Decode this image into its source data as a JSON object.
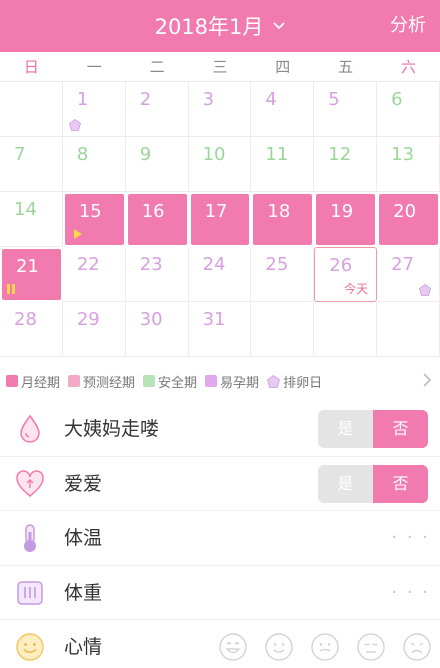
{
  "header": {
    "month": "2018年1月",
    "analyze": "分析"
  },
  "weekdays": [
    "日",
    "一",
    "二",
    "三",
    "四",
    "五",
    "六"
  ],
  "calendar": {
    "days": [
      {
        "n": "1"
      },
      {
        "n": "2"
      },
      {
        "n": "3"
      },
      {
        "n": "4"
      },
      {
        "n": "5"
      },
      {
        "n": "6"
      },
      {
        "n": "7"
      },
      {
        "n": "8"
      },
      {
        "n": "9"
      },
      {
        "n": "10"
      },
      {
        "n": "11"
      },
      {
        "n": "12"
      },
      {
        "n": "13"
      },
      {
        "n": "14"
      },
      {
        "n": "15"
      },
      {
        "n": "16"
      },
      {
        "n": "17"
      },
      {
        "n": "18"
      },
      {
        "n": "19"
      },
      {
        "n": "20"
      },
      {
        "n": "21"
      },
      {
        "n": "22"
      },
      {
        "n": "23"
      },
      {
        "n": "24"
      },
      {
        "n": "25"
      },
      {
        "n": "26"
      },
      {
        "n": "27"
      },
      {
        "n": "28"
      },
      {
        "n": "29"
      },
      {
        "n": "30"
      },
      {
        "n": "31"
      }
    ],
    "today_label": "今天"
  },
  "legend": {
    "items": [
      {
        "label": "月经期",
        "color": "#f17aae"
      },
      {
        "label": "预测经期",
        "color": "#f4a9c9"
      },
      {
        "label": "安全期",
        "color": "#b8e3b6"
      },
      {
        "label": "易孕期",
        "color": "#e2a8ec"
      },
      {
        "label": "排卵日",
        "color": "#e8c9f2"
      }
    ]
  },
  "records": {
    "period": {
      "label": "大姨妈走喽",
      "yes": "是",
      "no": "否"
    },
    "love": {
      "label": "爱爱",
      "yes": "是",
      "no": "否"
    },
    "temperature": {
      "label": "体温",
      "more": "· · ·"
    },
    "weight": {
      "label": "体重",
      "more": "· · ·"
    },
    "mood": {
      "label": "心情"
    }
  }
}
